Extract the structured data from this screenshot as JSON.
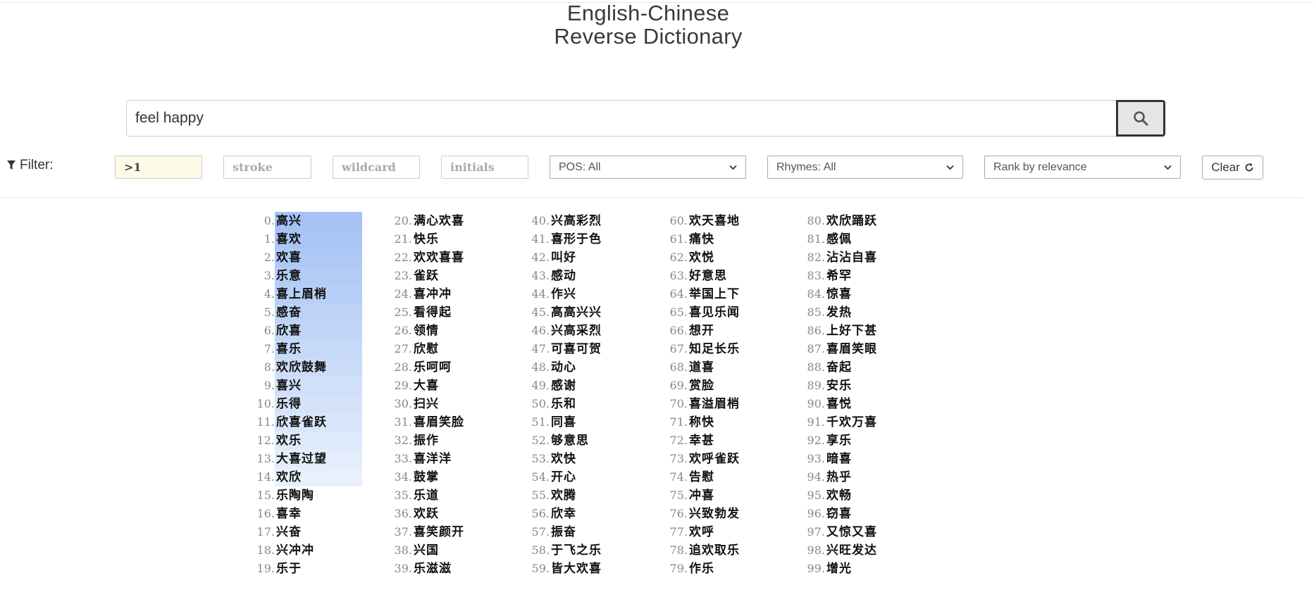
{
  "header": {
    "title_line1": "English-Chinese",
    "title_line2": "Reverse Dictionary"
  },
  "search": {
    "value": "feel happy",
    "icon": "search-icon"
  },
  "filter": {
    "label": "Filter:",
    "icon": "funnel-icon",
    "length": {
      "value": ">1",
      "placeholder": ""
    },
    "stroke": {
      "value": "",
      "placeholder": "stroke"
    },
    "wildcard": {
      "value": "",
      "placeholder": "wildcard"
    },
    "initials": {
      "value": "",
      "placeholder": "initials"
    },
    "pos": "POS: All",
    "rhymes": "Rhymes: All",
    "rank": "Rank by relevance",
    "clear_label": "Clear",
    "clear_icon": "refresh-icon"
  },
  "colors": {
    "highlight_strong": "#a4c2f4",
    "highlight_light": "#e8f0fc"
  },
  "results": [
    {
      "i": "0.",
      "w": "高兴"
    },
    {
      "i": "1.",
      "w": "喜欢"
    },
    {
      "i": "2.",
      "w": "欢喜"
    },
    {
      "i": "3.",
      "w": "乐意"
    },
    {
      "i": "4.",
      "w": "喜上眉梢"
    },
    {
      "i": "5.",
      "w": "感奋"
    },
    {
      "i": "6.",
      "w": "欣喜"
    },
    {
      "i": "7.",
      "w": "喜乐"
    },
    {
      "i": "8.",
      "w": "欢欣鼓舞"
    },
    {
      "i": "9.",
      "w": "喜兴"
    },
    {
      "i": "10.",
      "w": "乐得"
    },
    {
      "i": "11.",
      "w": "欣喜雀跃"
    },
    {
      "i": "12.",
      "w": "欢乐"
    },
    {
      "i": "13.",
      "w": "大喜过望"
    },
    {
      "i": "14.",
      "w": "欢欣"
    },
    {
      "i": "15.",
      "w": "乐陶陶"
    },
    {
      "i": "16.",
      "w": "喜幸"
    },
    {
      "i": "17.",
      "w": "兴奋"
    },
    {
      "i": "18.",
      "w": "兴冲冲"
    },
    {
      "i": "19.",
      "w": "乐于"
    },
    {
      "i": "20.",
      "w": "满心欢喜"
    },
    {
      "i": "21.",
      "w": "快乐"
    },
    {
      "i": "22.",
      "w": "欢欢喜喜"
    },
    {
      "i": "23.",
      "w": "雀跃"
    },
    {
      "i": "24.",
      "w": "喜冲冲"
    },
    {
      "i": "25.",
      "w": "看得起"
    },
    {
      "i": "26.",
      "w": "领情"
    },
    {
      "i": "27.",
      "w": "欣慰"
    },
    {
      "i": "28.",
      "w": "乐呵呵"
    },
    {
      "i": "29.",
      "w": "大喜"
    },
    {
      "i": "30.",
      "w": "扫兴"
    },
    {
      "i": "31.",
      "w": "喜眉笑脸"
    },
    {
      "i": "32.",
      "w": "振作"
    },
    {
      "i": "33.",
      "w": "喜洋洋"
    },
    {
      "i": "34.",
      "w": "鼓掌"
    },
    {
      "i": "35.",
      "w": "乐道"
    },
    {
      "i": "36.",
      "w": "欢跃"
    },
    {
      "i": "37.",
      "w": "喜笑颜开"
    },
    {
      "i": "38.",
      "w": "兴国"
    },
    {
      "i": "39.",
      "w": "乐滋滋"
    },
    {
      "i": "40.",
      "w": "兴高彩烈"
    },
    {
      "i": "41.",
      "w": "喜形于色"
    },
    {
      "i": "42.",
      "w": "叫好"
    },
    {
      "i": "43.",
      "w": "感动"
    },
    {
      "i": "44.",
      "w": "作兴"
    },
    {
      "i": "45.",
      "w": "高高兴兴"
    },
    {
      "i": "46.",
      "w": "兴高采烈"
    },
    {
      "i": "47.",
      "w": "可喜可贺"
    },
    {
      "i": "48.",
      "w": "动心"
    },
    {
      "i": "49.",
      "w": "感谢"
    },
    {
      "i": "50.",
      "w": "乐和"
    },
    {
      "i": "51.",
      "w": "同喜"
    },
    {
      "i": "52.",
      "w": "够意思"
    },
    {
      "i": "53.",
      "w": "欢快"
    },
    {
      "i": "54.",
      "w": "开心"
    },
    {
      "i": "55.",
      "w": "欢腾"
    },
    {
      "i": "56.",
      "w": "欣幸"
    },
    {
      "i": "57.",
      "w": "振奋"
    },
    {
      "i": "58.",
      "w": "于飞之乐"
    },
    {
      "i": "59.",
      "w": "皆大欢喜"
    },
    {
      "i": "60.",
      "w": "欢天喜地"
    },
    {
      "i": "61.",
      "w": "痛快"
    },
    {
      "i": "62.",
      "w": "欢悦"
    },
    {
      "i": "63.",
      "w": "好意思"
    },
    {
      "i": "64.",
      "w": "举国上下"
    },
    {
      "i": "65.",
      "w": "喜见乐闻"
    },
    {
      "i": "66.",
      "w": "想开"
    },
    {
      "i": "67.",
      "w": "知足长乐"
    },
    {
      "i": "68.",
      "w": "道喜"
    },
    {
      "i": "69.",
      "w": "赏脸"
    },
    {
      "i": "70.",
      "w": "喜溢眉梢"
    },
    {
      "i": "71.",
      "w": "称快"
    },
    {
      "i": "72.",
      "w": "幸甚"
    },
    {
      "i": "73.",
      "w": "欢呼雀跃"
    },
    {
      "i": "74.",
      "w": "告慰"
    },
    {
      "i": "75.",
      "w": "冲喜"
    },
    {
      "i": "76.",
      "w": "兴致勃发"
    },
    {
      "i": "77.",
      "w": "欢呼"
    },
    {
      "i": "78.",
      "w": "追欢取乐"
    },
    {
      "i": "79.",
      "w": "作乐"
    },
    {
      "i": "80.",
      "w": "欢欣踊跃"
    },
    {
      "i": "81.",
      "w": "感佩"
    },
    {
      "i": "82.",
      "w": "沾沾自喜"
    },
    {
      "i": "83.",
      "w": "希罕"
    },
    {
      "i": "84.",
      "w": "惊喜"
    },
    {
      "i": "85.",
      "w": "发热"
    },
    {
      "i": "86.",
      "w": "上好下甚"
    },
    {
      "i": "87.",
      "w": "喜眉笑眼"
    },
    {
      "i": "88.",
      "w": "奋起"
    },
    {
      "i": "89.",
      "w": "安乐"
    },
    {
      "i": "90.",
      "w": "喜悦"
    },
    {
      "i": "91.",
      "w": "千欢万喜"
    },
    {
      "i": "92.",
      "w": "享乐"
    },
    {
      "i": "93.",
      "w": "暗喜"
    },
    {
      "i": "94.",
      "w": "热乎"
    },
    {
      "i": "95.",
      "w": "欢畅"
    },
    {
      "i": "96.",
      "w": "窃喜"
    },
    {
      "i": "97.",
      "w": "又惊又喜"
    },
    {
      "i": "98.",
      "w": "兴旺发达"
    },
    {
      "i": "99.",
      "w": "增光"
    }
  ]
}
